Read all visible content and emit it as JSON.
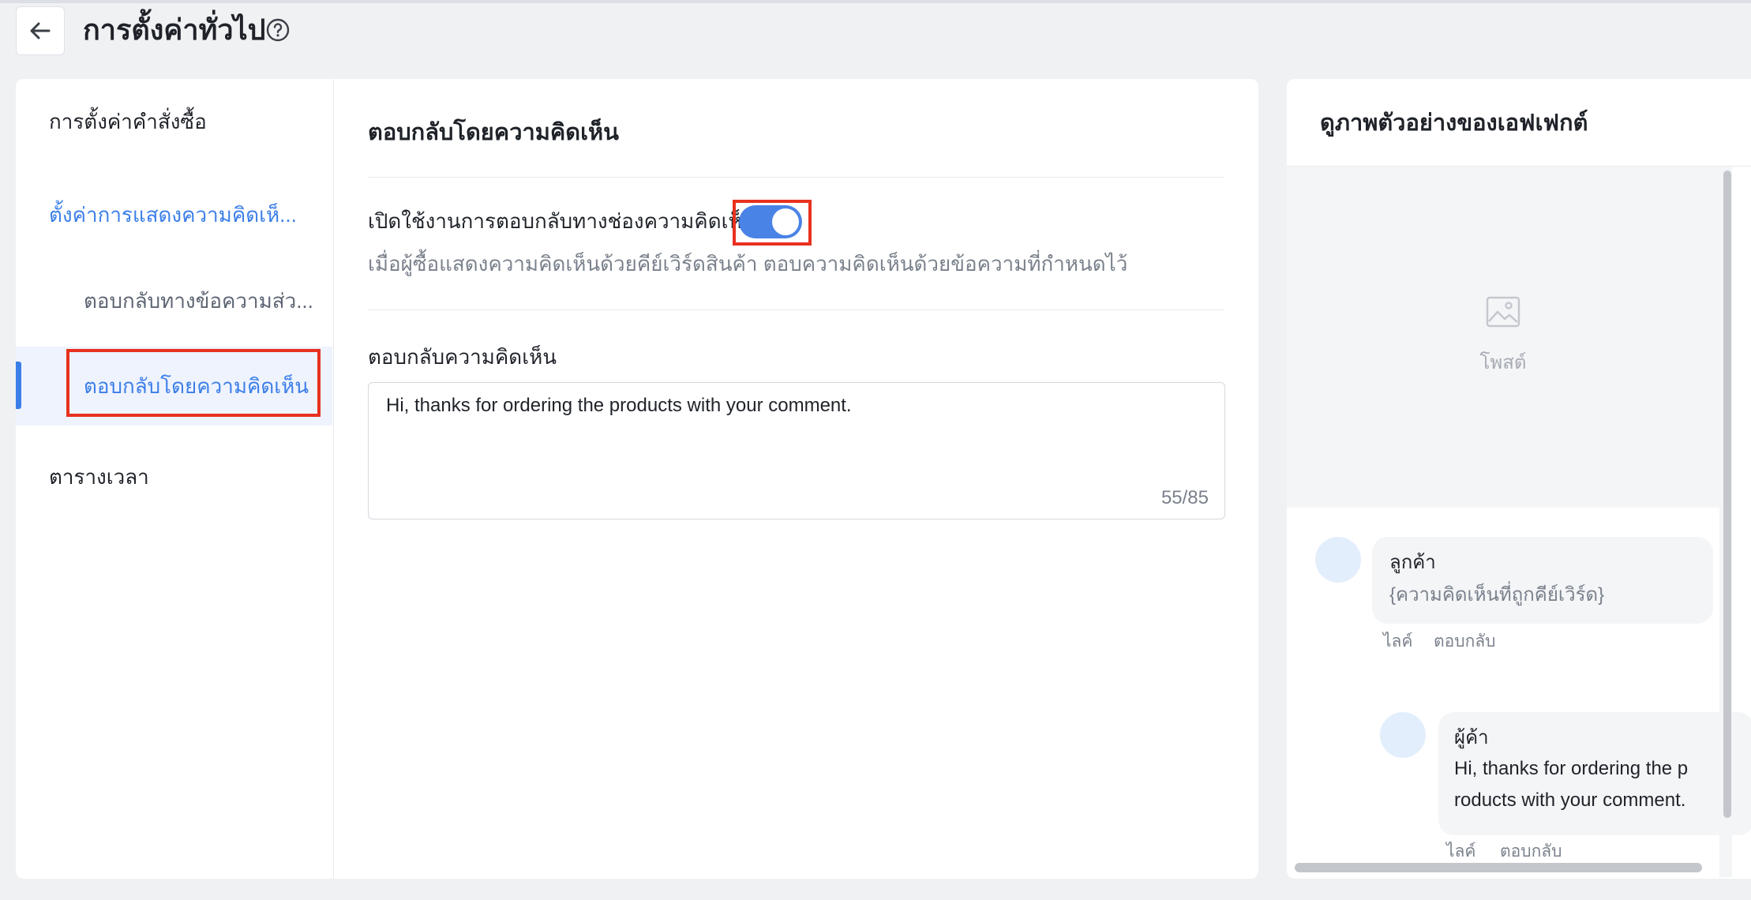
{
  "header": {
    "back_label": "←",
    "title": "การตั้งค่าทั่วไป",
    "help_icon": "question-circle-icon"
  },
  "nav": {
    "items": [
      {
        "label": "การตั้งค่าคำสั่งซื้อ"
      },
      {
        "label": "ตั้งค่าการแสดงความคิดเห็..."
      },
      {
        "label": "ตอบกลับทางข้อความส่ว..."
      },
      {
        "label": "ตอบกลับโดยความคิดเห็น"
      },
      {
        "label": "ตารางเวลา"
      }
    ],
    "active_index": 3
  },
  "content": {
    "section_title": "ตอบกลับโดยความคิดเห็น",
    "toggle_label": "เปิดใช้งานการตอบกลับทางช่องความคิดเห็น",
    "toggle_on": true,
    "toggle_description": "เมื่อผู้ซื้อแสดงความคิดเห็นด้วยคีย์เวิร์ดสินค้า ตอบความคิดเห็นด้วยข้อความที่กำหนดไว้",
    "reply_label": "ตอบกลับความคิดเห็น",
    "reply_value": "Hi, thanks for ordering the products with your comment.",
    "char_counter": "55/85"
  },
  "preview": {
    "title": "ดูภาพตัวอย่างของเอฟเฟกต์",
    "post_label": "โพสต์",
    "customer_name": "ลูกค้า",
    "customer_comment": "{ความคิดเห็นที่ถูกคีย์เวิร์ด}",
    "like_label": "ไลค์",
    "reply_label": "ตอบกลับ",
    "seller_name": "ผู้ค้า",
    "seller_reply_line1": "Hi, thanks for ordering the p",
    "seller_reply_line2": "roducts with your comment."
  },
  "colors": {
    "accent": "#3b7ee8",
    "toggle_on": "#4a83e6",
    "highlight_box": "#e8311f"
  }
}
